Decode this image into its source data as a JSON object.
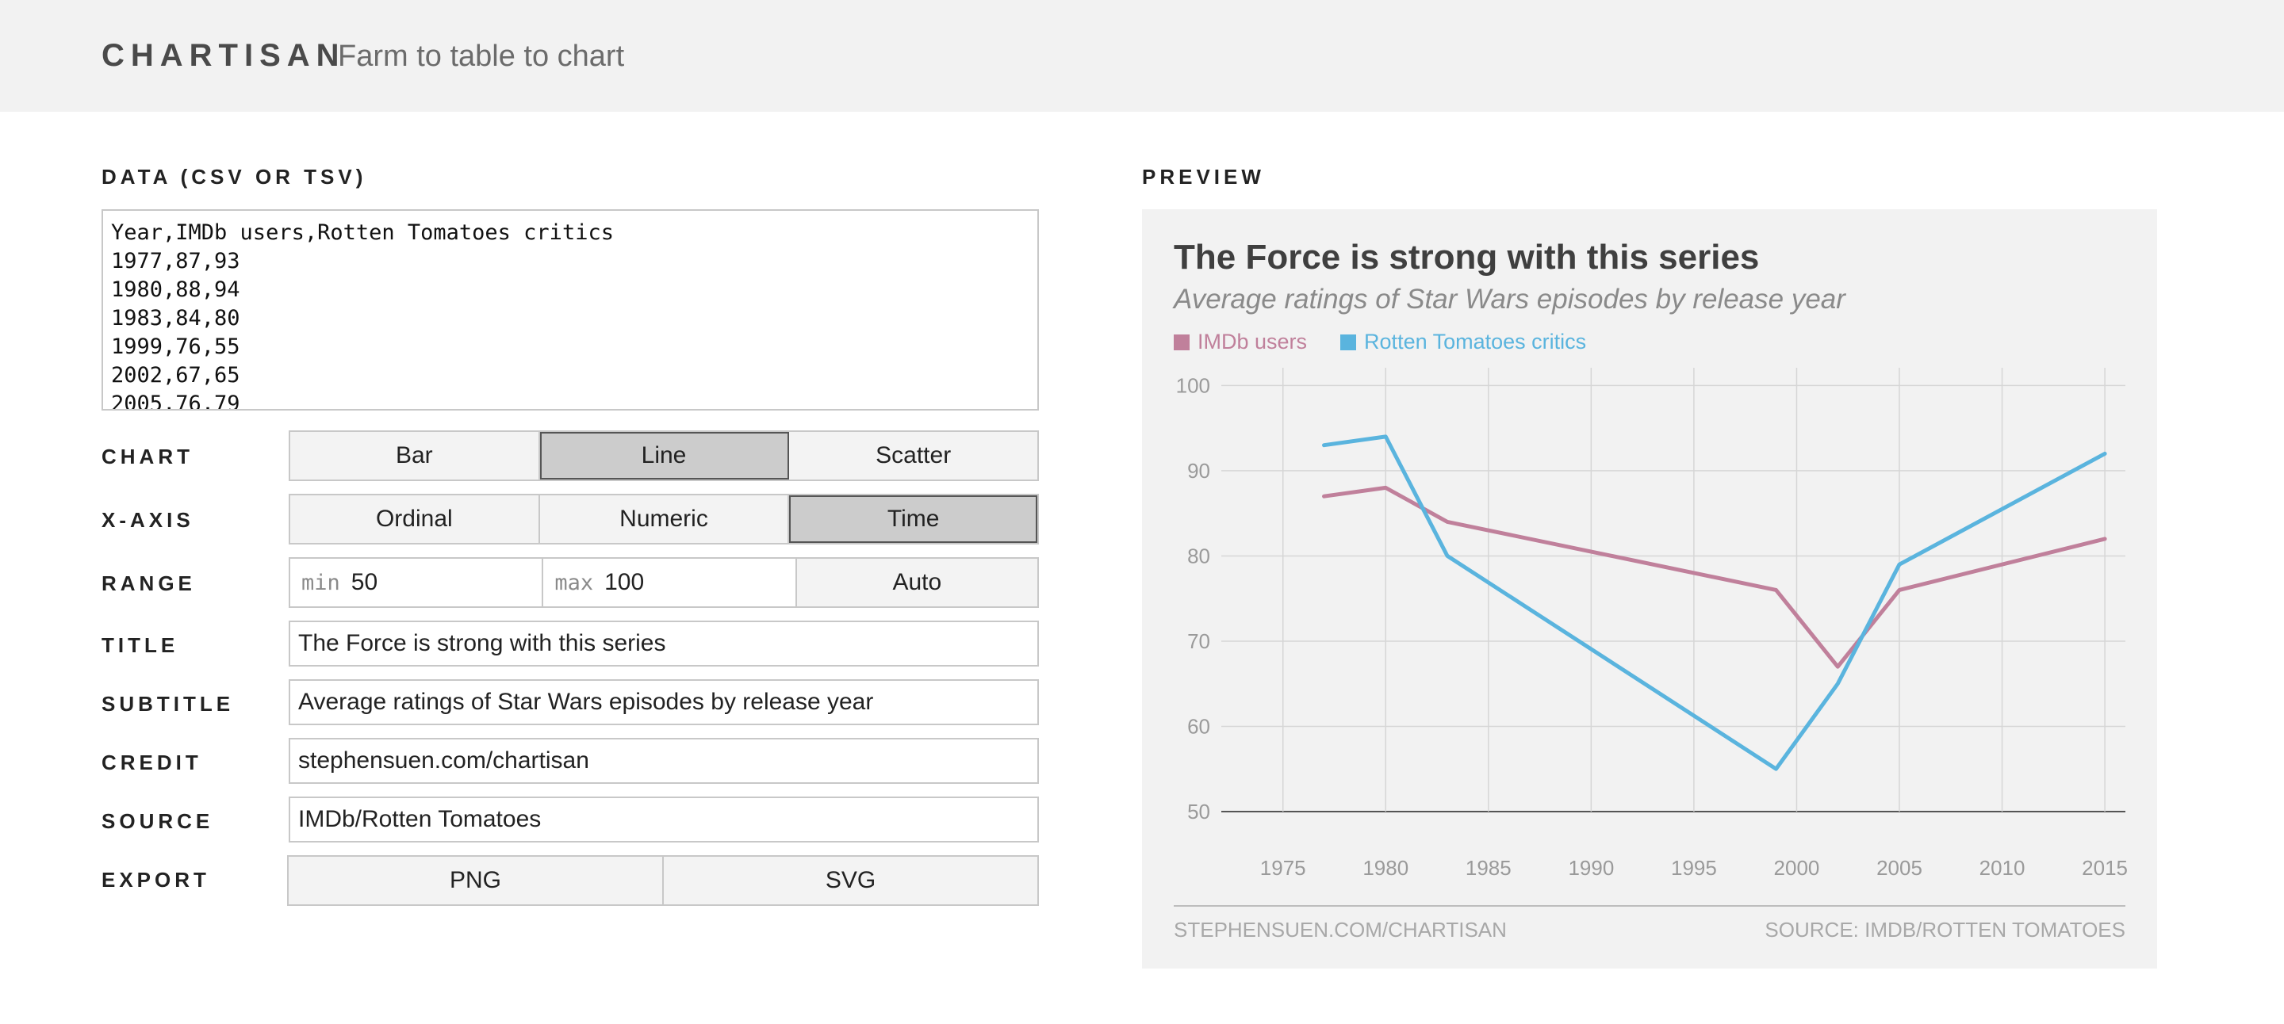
{
  "header": {
    "brand": "CHARTISAN",
    "tagline": "Farm to table to chart"
  },
  "editor": {
    "data_label": "DATA (CSV OR TSV)",
    "csv_text": "Year,IMDb users,Rotten Tomatoes critics\n1977,87,93\n1980,88,94\n1983,84,80\n1999,76,55\n2002,67,65\n2005,76,79",
    "chart_label": "CHART",
    "chart_options": [
      "Bar",
      "Line",
      "Scatter"
    ],
    "chart_selected": "Line",
    "xaxis_label": "X-AXIS",
    "xaxis_options": [
      "Ordinal",
      "Numeric",
      "Time"
    ],
    "xaxis_selected": "Time",
    "range_label": "RANGE",
    "range_min_key": "min",
    "range_min": "50",
    "range_max_key": "max",
    "range_max": "100",
    "range_auto": "Auto",
    "title_label": "TITLE",
    "title_value": "The Force is strong with this series",
    "subtitle_label": "SUBTITLE",
    "subtitle_value": "Average ratings of Star Wars episodes by release year",
    "credit_label": "CREDIT",
    "credit_value": "stephensuen.com/chartisan",
    "source_label": "SOURCE",
    "source_value": "IMDb/Rotten Tomatoes",
    "export_label": "EXPORT",
    "export_png": "PNG",
    "export_svg": "SVG"
  },
  "preview": {
    "label": "PREVIEW",
    "credit": "STEPHENSUEN.COM/CHARTISAN",
    "source": "SOURCE: IMDB/ROTTEN TOMATOES"
  },
  "colors": {
    "imdb": "#c0809b",
    "rt": "#5ab4de",
    "grid": "#d6d6d6",
    "axis": "#555555",
    "tick": "#9a9a9a"
  },
  "chart_data": {
    "type": "line",
    "title": "The Force is strong with this series",
    "subtitle": "Average ratings of Star Wars episodes by release year",
    "xlabel": "",
    "ylabel": "",
    "x": [
      1977,
      1980,
      1983,
      1999,
      2002,
      2005,
      2015
    ],
    "series": [
      {
        "name": "IMDb users",
        "values": [
          87,
          88,
          84,
          76,
          67,
          76,
          82
        ]
      },
      {
        "name": "Rotten Tomatoes critics",
        "values": [
          93,
          94,
          80,
          55,
          65,
          79,
          92
        ]
      }
    ],
    "xlim": [
      1972,
      2016
    ],
    "ylim": [
      50,
      100
    ],
    "xticks": [
      1975,
      1980,
      1985,
      1990,
      1995,
      2000,
      2005,
      2010,
      2015
    ],
    "yticks": [
      50,
      60,
      70,
      80,
      90,
      100
    ],
    "grid": true,
    "legend": "top-left"
  }
}
